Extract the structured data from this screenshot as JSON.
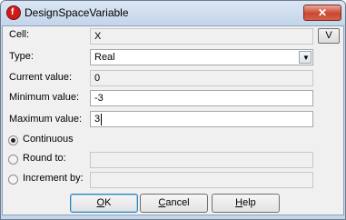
{
  "window": {
    "title": "DesignSpaceVariable",
    "app_icon": "f",
    "close_glyph": "✕"
  },
  "form": {
    "cell_label": "Cell:",
    "cell_value": "X",
    "v_button": "V",
    "type_label": "Type:",
    "type_value": "Real",
    "current_label": "Current value:",
    "current_value": "0",
    "min_label": "Minimum value:",
    "min_value": "-3",
    "max_label": "Maximum value:",
    "max_value": "3"
  },
  "options": {
    "continuous": "Continuous",
    "round_to": "Round to:",
    "increment_by": "Increment by:",
    "selected": "Continuous"
  },
  "buttons": {
    "ok_mn": "O",
    "ok_rest": "K",
    "cancel_mn": "C",
    "cancel_rest": "ancel",
    "help_mn": "H",
    "help_rest": "elp"
  }
}
